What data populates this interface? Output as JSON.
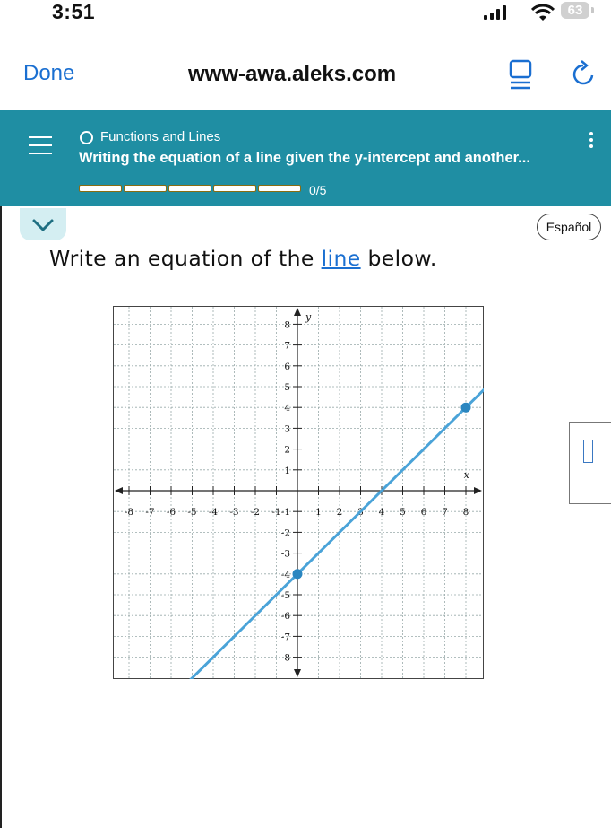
{
  "status_bar": {
    "time": "3:51",
    "battery": "63"
  },
  "browser": {
    "done_label": "Done",
    "url": "www-awa.aleks.com"
  },
  "header": {
    "topic": "Functions and Lines",
    "title": "Writing the equation of a line given the y-intercept and another...",
    "progress_text": "0/5",
    "progress_segments": 5,
    "accent_color": "#1f8ea3"
  },
  "language_button": "Español",
  "question": {
    "prefix": "Write an equation of the ",
    "link": "line",
    "suffix": " below."
  },
  "chart_data": {
    "type": "line",
    "xlim": [
      -8,
      8
    ],
    "ylim": [
      -8,
      8
    ],
    "xlabel": "x",
    "ylabel": "y",
    "grid": true,
    "x_ticks": [
      "-8",
      "-7",
      "-6",
      "-5",
      "-4",
      "-3",
      "-2",
      "-1",
      "1",
      "2",
      "3",
      "4",
      "5",
      "6",
      "7",
      "8"
    ],
    "y_ticks": [
      "8",
      "7",
      "6",
      "5",
      "4",
      "3",
      "2",
      "1",
      "-1",
      "-2",
      "-3",
      "-4",
      "-5",
      "-6",
      "-7",
      "-8"
    ],
    "series": [
      {
        "points": [
          [
            0,
            -4
          ],
          [
            8,
            4
          ]
        ],
        "color": "#4aa3d8",
        "extends": true
      }
    ],
    "marked_points": [
      [
        0,
        -4
      ],
      [
        8,
        4
      ]
    ]
  }
}
